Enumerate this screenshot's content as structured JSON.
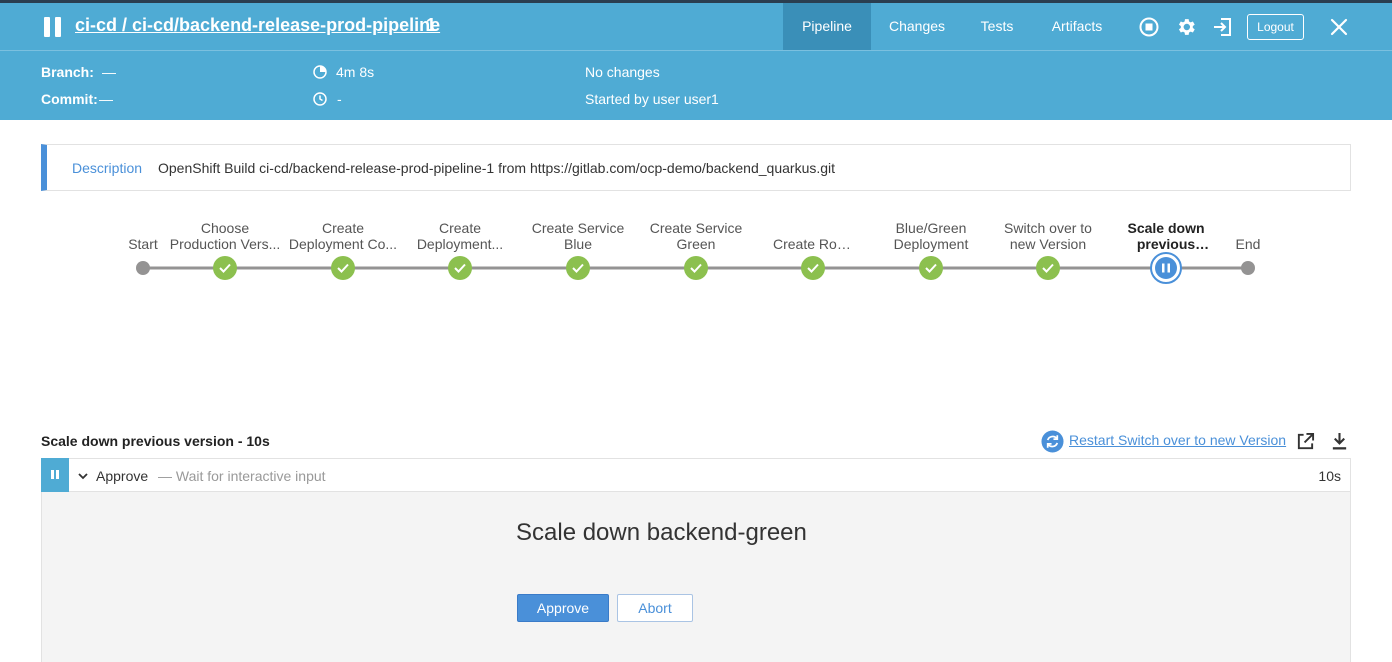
{
  "header": {
    "breadcrumb": "ci-cd / ci-cd/backend-release-prod-pipeline",
    "run_number": "1",
    "tabs": [
      {
        "label": "Pipeline",
        "active": true
      },
      {
        "label": "Changes",
        "active": false
      },
      {
        "label": "Tests",
        "active": false
      },
      {
        "label": "Artifacts",
        "active": false
      }
    ],
    "logout_label": "Logout"
  },
  "meta": {
    "branch_label": "Branch:",
    "branch_value": "—",
    "commit_label": "Commit:",
    "commit_value": "—",
    "duration": "4m 8s",
    "time_ago": "-",
    "changes": "No changes",
    "started_by": "Started by user user1"
  },
  "description": {
    "label": "Description",
    "text": "OpenShift Build ci-cd/backend-release-prod-pipeline-1 from https://gitlab.com/ocp-demo/backend_quarkus.git"
  },
  "stages": [
    {
      "label": "Start",
      "status": "start"
    },
    {
      "label": "Choose Production Vers...",
      "status": "success"
    },
    {
      "label": "Create Deployment Co...",
      "status": "success"
    },
    {
      "label": "Create Deployment...",
      "status": "success"
    },
    {
      "label": "Create Service Blue",
      "status": "success"
    },
    {
      "label": "Create Service Green",
      "status": "success"
    },
    {
      "label": "Create Route",
      "status": "success"
    },
    {
      "label": "Blue/Green Deployment",
      "status": "success"
    },
    {
      "label": "Switch over to new Version",
      "status": "success"
    },
    {
      "label": "Scale down previous version",
      "status": "paused"
    },
    {
      "label": "End",
      "status": "end"
    }
  ],
  "step_panel": {
    "title": "Scale down previous version - 10s",
    "restart_label": "Restart Switch over to new Version",
    "step_name": "Approve",
    "step_desc": "— Wait for interactive input",
    "step_duration": "10s",
    "input_message": "Scale down backend-green",
    "approve_label": "Approve",
    "abort_label": "Abort"
  },
  "colors": {
    "header": "#4fabd4",
    "success": "#8cc04f",
    "paused": "#4a90d9",
    "connector": "#949393"
  }
}
